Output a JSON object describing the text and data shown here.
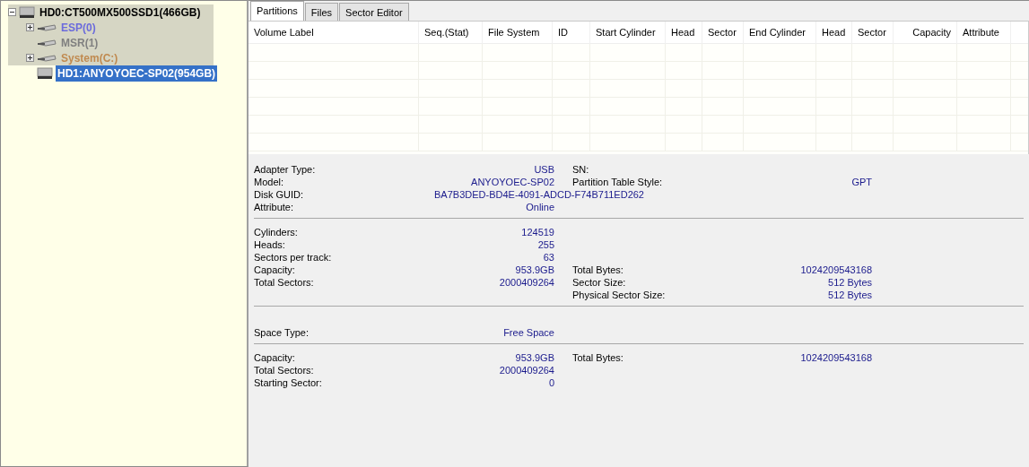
{
  "tree": [
    {
      "label": "HD0:CT500MX500SSD1(466GB)",
      "expanded": true,
      "selected": false,
      "children": [
        {
          "label": "ESP(0)",
          "color": "#6b6bdc",
          "expanded": false,
          "selected": false
        },
        {
          "label": "MSR(1)",
          "color": "#808080",
          "selected": false
        },
        {
          "label": "System(C:)",
          "color": "#c08a50",
          "expanded": false,
          "selected": false
        }
      ]
    },
    {
      "label": "HD1:ANYOYOEC-SP02(954GB)",
      "selected": true
    }
  ],
  "tabs": [
    {
      "label": "Partitions",
      "selected": true
    },
    {
      "label": "Files",
      "selected": false
    },
    {
      "label": "Sector Editor",
      "selected": false
    }
  ],
  "table": {
    "columns": [
      "Volume Label",
      "Seq.(Stat)",
      "File System",
      "ID",
      "Start Cylinder",
      "Head",
      "Sector",
      "End Cylinder",
      "Head",
      "Sector",
      "Capacity",
      "Attribute"
    ]
  },
  "info_sections": [
    {
      "rows": [
        {
          "kind": "pair",
          "label": "Adapter Type:",
          "value": "USB",
          "right_label": "SN:"
        },
        {
          "kind": "pair",
          "label": "Model:",
          "value": "ANYOYOEC-SP02",
          "right_label": "Partition Table Style:",
          "right_value": "GPT"
        },
        {
          "kind": "wide",
          "label": "Disk GUID:",
          "value": "BA7B3DED-BD4E-4091-ADCD-F74B711ED262"
        },
        {
          "kind": "pair",
          "label": "Attribute:",
          "value": "Online"
        }
      ]
    },
    {
      "rows": [
        {
          "kind": "pair",
          "label": "Cylinders:",
          "value": "124519"
        },
        {
          "kind": "pair",
          "label": "Heads:",
          "value": "255"
        },
        {
          "kind": "pair",
          "label": "Sectors per track:",
          "value": "63"
        },
        {
          "kind": "pair",
          "label": "Capacity:",
          "value": "953.9GB",
          "right_label": "Total Bytes:",
          "right_value": "1024209543168"
        },
        {
          "kind": "pair",
          "label": "Total Sectors:",
          "value": "2000409264",
          "right_label": "Sector Size:",
          "right_value": "512 Bytes"
        },
        {
          "kind": "pair",
          "right_label": "Physical Sector Size:",
          "right_value": "512 Bytes"
        }
      ]
    },
    {
      "rows": [
        {
          "kind": "pair",
          "label": "Space Type:",
          "value": "Free Space"
        }
      ]
    },
    {
      "rows": [
        {
          "kind": "pair",
          "label": "Capacity:",
          "value": "953.9GB",
          "right_label": "Total Bytes:",
          "right_value": "1024209543168"
        },
        {
          "kind": "pair",
          "label": "Total Sectors:",
          "value": "2000409264"
        },
        {
          "kind": "pair",
          "label": "Starting Sector:",
          "value": "0"
        }
      ]
    }
  ]
}
